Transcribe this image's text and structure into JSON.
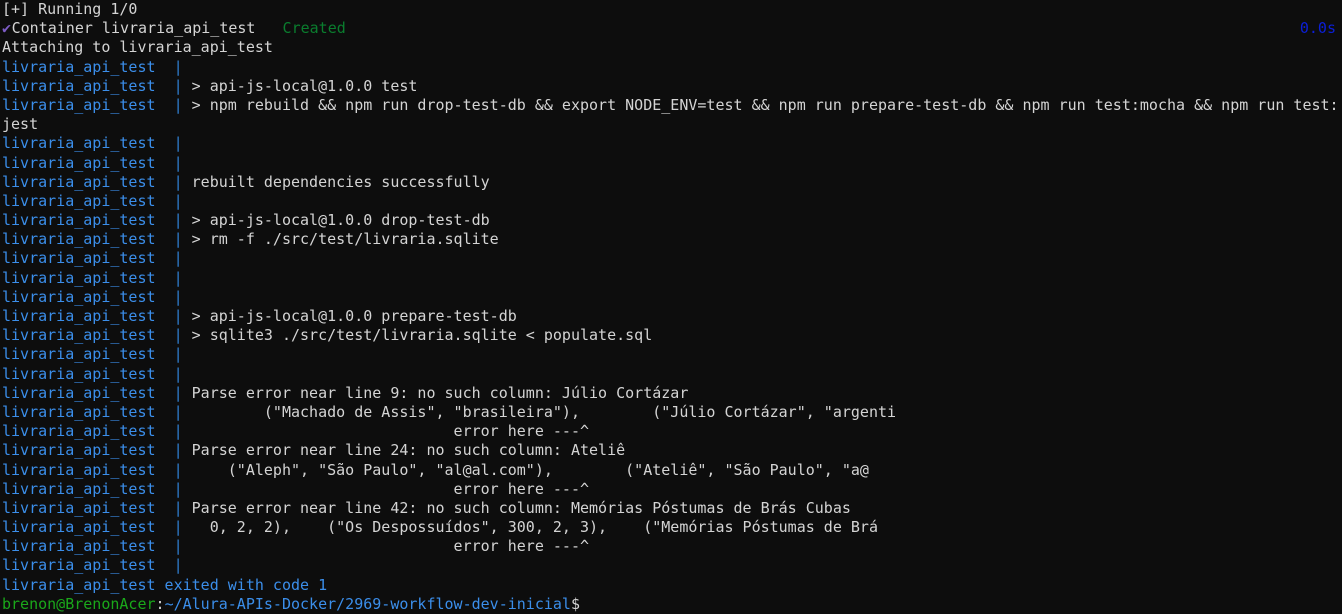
{
  "terminal": {
    "background_color": "#0d0d0d",
    "foreground_color": "#d4d4d4",
    "service_name": "livraria_api_test",
    "pipe": "|",
    "compose_status": {
      "running_header": "[+] Running 1/0",
      "check_icon": "✔",
      "check_color": "#7d5cc6",
      "container_label": "Container livraria_api_test",
      "container_state": "Created",
      "state_color": "#0a7d2e",
      "elapsed": "0.0s",
      "elapsed_color": "#0b1fd8",
      "attaching_line": "Attaching to livraria_api_test"
    },
    "log_lines": [
      "",
      "> api-js-local@1.0.0 test",
      "> npm rebuild && npm run drop-test-db && export NODE_ENV=test && npm run prepare-test-db && npm run test:mocha && npm run test:",
      "",
      "",
      "rebuilt dependencies successfully",
      "",
      "> api-js-local@1.0.0 drop-test-db",
      "> rm -f ./src/test/livraria.sqlite",
      "",
      "",
      "",
      "> api-js-local@1.0.0 prepare-test-db",
      "> sqlite3 ./src/test/livraria.sqlite < populate.sql",
      "",
      "",
      "Parse error near line 9: no such column: Júlio Cortázar",
      "        (\"Machado de Assis\", \"brasileira\"),        (\"Júlio Cortázar\", \"argenti",
      "                             error here ---^",
      "Parse error near line 24: no such column: Ateliê",
      "    (\"Aleph\", \"São Paulo\", \"al@al.com\"),        (\"Ateliê\", \"São Paulo\", \"a@",
      "                             error here ---^",
      "Parse error near line 42: no such column: Memórias Póstumas de Brás Cubas",
      "  0, 2, 2),    (\"Os Despossuídos\", 300, 2, 3),    (\"Memórias Póstumas de Brá",
      "                             error here ---^",
      ""
    ],
    "wrapped_continuation": "jest",
    "wrapped_after_index": 2,
    "exit_line": "livraria_api_test exited with code 1",
    "prompt": {
      "user_host": "brenon@BrenonAcer",
      "separator": ":",
      "path": "~/Alura-APIs-Docker/2969-workflow-dev-inicial",
      "symbol": "$"
    }
  }
}
